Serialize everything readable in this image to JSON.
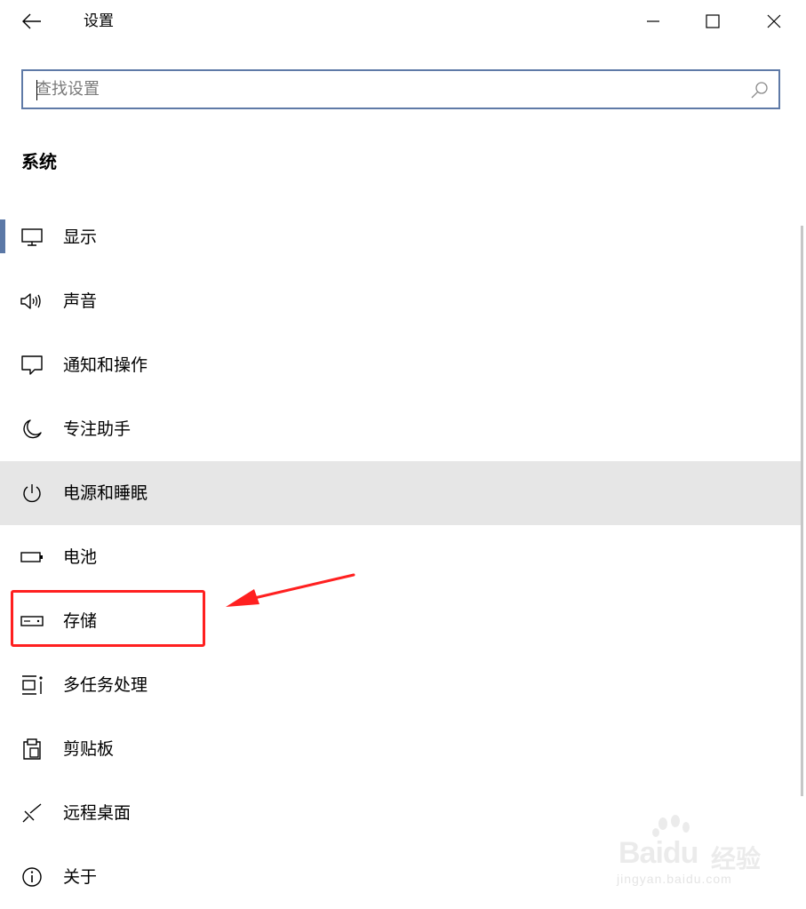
{
  "window": {
    "title": "设置",
    "controls": {
      "minimize": "minimize-icon",
      "maximize": "maximize-icon",
      "close": "close-icon"
    }
  },
  "search": {
    "value": "",
    "placeholder": "查找设置",
    "icon": "search-icon"
  },
  "section": {
    "title": "系统"
  },
  "nav": {
    "active_index": 0,
    "hover_index": 4,
    "items": [
      {
        "label": "显示",
        "icon": "monitor-icon"
      },
      {
        "label": "声音",
        "icon": "speaker-icon"
      },
      {
        "label": "通知和操作",
        "icon": "notification-icon"
      },
      {
        "label": "专注助手",
        "icon": "moon-icon"
      },
      {
        "label": "电源和睡眠",
        "icon": "power-icon"
      },
      {
        "label": "电池",
        "icon": "battery-icon"
      },
      {
        "label": "存储",
        "icon": "storage-drive-icon"
      },
      {
        "label": "多任务处理",
        "icon": "multitasking-icon"
      },
      {
        "label": "剪贴板",
        "icon": "clipboard-icon"
      },
      {
        "label": "远程桌面",
        "icon": "remote-desktop-icon"
      },
      {
        "label": "关于",
        "icon": "info-icon"
      }
    ]
  },
  "annotation": {
    "highlighted_item": "存储",
    "color": "#ff2020"
  },
  "colors": {
    "accent": "#5b78a6",
    "hover_background": "#e6e6e6"
  },
  "watermark": {
    "logo": "Baidu",
    "text": "经验",
    "url": "jingyan.baidu.com"
  }
}
